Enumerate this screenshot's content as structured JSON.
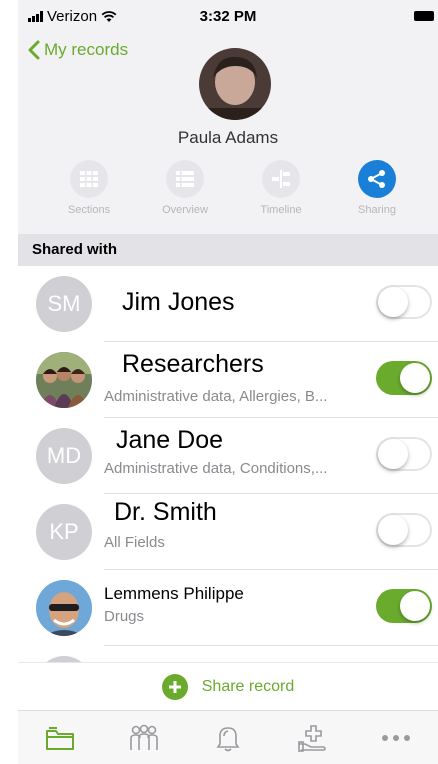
{
  "status": {
    "carrier": "Verizon",
    "time": "3:32 PM"
  },
  "nav": {
    "back_label": "My records"
  },
  "profile": {
    "name": "Paula Adams"
  },
  "tabs": [
    {
      "label": "Sections",
      "icon": "grid-icon"
    },
    {
      "label": "Overview",
      "icon": "list-icon"
    },
    {
      "label": "Timeline",
      "icon": "timeline-icon"
    },
    {
      "label": "Sharing",
      "icon": "share-icon",
      "active": true
    }
  ],
  "section": {
    "header": "Shared with"
  },
  "shares": [
    {
      "initials": "SM",
      "name": "Jim Jones",
      "sub": "",
      "enabled": false
    },
    {
      "initials": "",
      "name": "Researchers",
      "sub": "Administrative data, Allergies, B...",
      "enabled": true
    },
    {
      "initials": "MD",
      "name": "Jane Doe",
      "sub": "Administrative data, Conditions,...",
      "enabled": false
    },
    {
      "initials": "KP",
      "name": "Dr. Smith",
      "sub": "All Fields",
      "enabled": false
    },
    {
      "initials": "",
      "name": "Lemmens Philippe",
      "sub": "Drugs",
      "enabled": true
    }
  ],
  "share_button": {
    "label": "Share record"
  },
  "tabbar": [
    "records-icon",
    "people-icon",
    "bell-icon",
    "care-icon",
    "more-icon"
  ],
  "colors": {
    "accent": "#6aab2e",
    "active_tab": "#1a7fd6"
  }
}
